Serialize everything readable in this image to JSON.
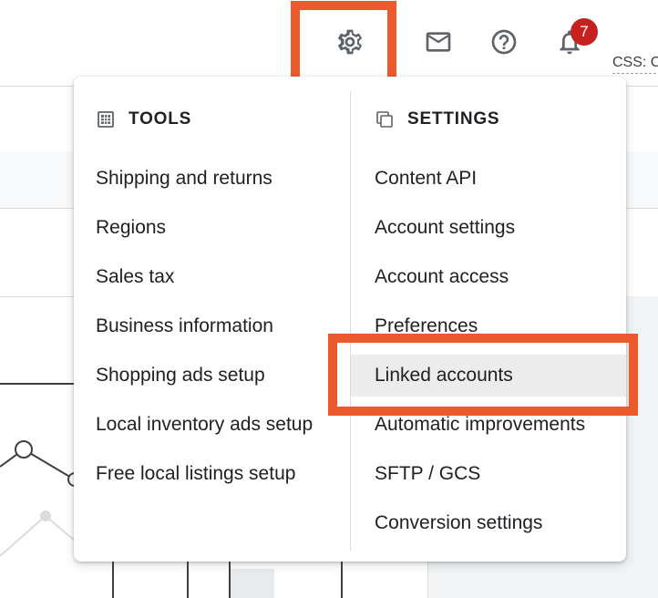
{
  "toolbar": {
    "icons": [
      "gear-icon",
      "mail-icon",
      "help-icon",
      "bell-icon"
    ],
    "notification_count": "7",
    "css_label": "CSS: C"
  },
  "menu": {
    "tools": {
      "title": "TOOLS",
      "icon": "table-icon",
      "items": [
        {
          "label": "Shipping and returns"
        },
        {
          "label": "Regions"
        },
        {
          "label": "Sales tax"
        },
        {
          "label": "Business information"
        },
        {
          "label": "Shopping ads setup"
        },
        {
          "label": "Local inventory ads setup"
        },
        {
          "label": "Free local listings setup"
        }
      ]
    },
    "settings": {
      "title": "SETTINGS",
      "icon": "copy-icon",
      "items": [
        {
          "label": "Content API"
        },
        {
          "label": "Account settings"
        },
        {
          "label": "Account access"
        },
        {
          "label": "Preferences"
        },
        {
          "label": "Linked accounts",
          "selected": true
        },
        {
          "label": "Automatic improvements"
        },
        {
          "label": "SFTP / GCS"
        },
        {
          "label": "Conversion settings"
        }
      ]
    }
  },
  "colors": {
    "highlight": "#ea5a2d",
    "badge": "#c5221f",
    "selected_row": "#ececec"
  }
}
